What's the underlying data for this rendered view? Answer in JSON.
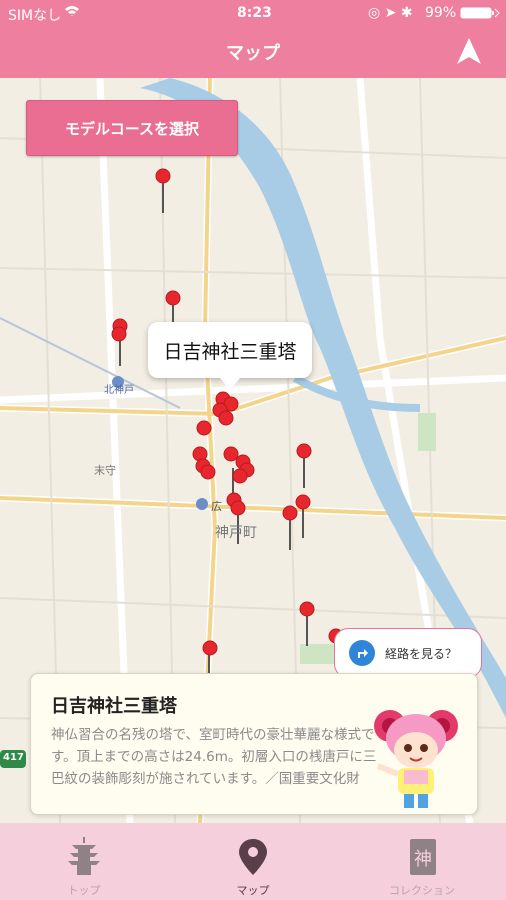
{
  "status_bar": {
    "carrier": "SIMなし",
    "time": "8:23",
    "battery": "99%"
  },
  "nav": {
    "title": "マップ",
    "locate_icon": "navigation-arrow-icon"
  },
  "map": {
    "course_button": "モデルコースを選択",
    "selected_callout": "日吉神社三重塔",
    "labels": {
      "kita_kanbe": "北神戸",
      "suemori": "末守",
      "hiroshi": "広",
      "kanbe_cho": "神戸町",
      "route_417": "417"
    },
    "route_bubble": "経路を見る？"
  },
  "info_card": {
    "title": "日吉神社三重塔",
    "description": "神仏習合の名残の塔で、室町時代の豪壮華麗な様式です。頂上までの高さは24.6m。初層入口の桟唐戸に三巴紋の装飾彫刻が施されています。／国重要文化財"
  },
  "tabs": [
    {
      "label": "トップ",
      "icon": "pagoda-icon"
    },
    {
      "label": "マップ",
      "icon": "map-pin-icon"
    },
    {
      "label": "コレクション",
      "icon": "kami-card-icon"
    }
  ],
  "colors": {
    "accent": "#ee7f9f",
    "pin": "#e8262d",
    "river": "#a9cce6",
    "tabbar": "#f6cfdc"
  }
}
